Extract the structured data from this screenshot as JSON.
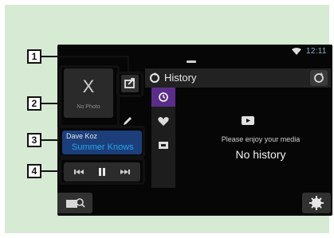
{
  "status": {
    "clock": "12:11"
  },
  "left": {
    "photo_label": "No Photo",
    "photo_mark": "X",
    "artist": "Dave Koz",
    "title": "Summer Knows"
  },
  "right": {
    "header_title": "History",
    "message": "Please enjoy your media",
    "empty": "No history"
  },
  "callouts": [
    "1",
    "2",
    "3",
    "4"
  ],
  "colors": {
    "panel": "#d6ead4",
    "accent_purple": "#5b2d8a",
    "title_blue": "#29a4e6",
    "song_card": "#1c3f7c"
  },
  "icons": [
    "wifi-icon",
    "share-icon",
    "pencil-icon",
    "previous-icon",
    "pause-icon",
    "next-icon",
    "search-icon",
    "history-icon",
    "heart-icon",
    "photo-icon",
    "refresh-icon",
    "youtube-icon",
    "settings-icon"
  ]
}
